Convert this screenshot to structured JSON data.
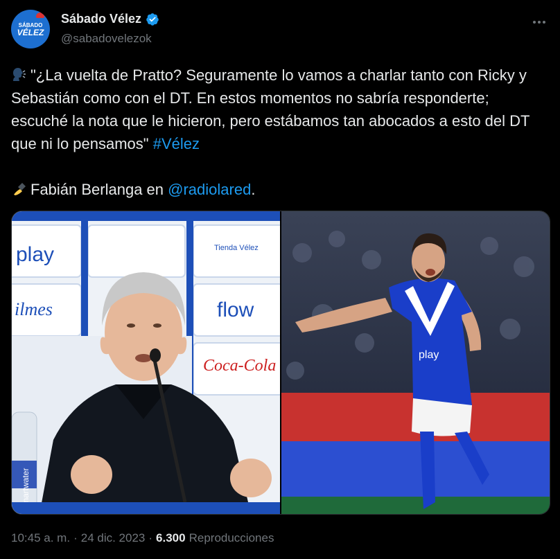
{
  "author": {
    "display_name": "Sábado Vélez",
    "handle": "@sabadovelezok",
    "avatar_text": "SÁBADO",
    "avatar_text2": "VÉLEZ",
    "avatar_icon": "avatar-logo",
    "verified_icon": "verified-badge-icon",
    "verified_color": "#1d9bf0"
  },
  "tweet": {
    "line1": "\"¿La vuelta de Pratto? Seguramente lo vamos a charlar tanto con Ricky y Sebastián como con el DT. En estos momentos no sabría responderte; escuché la nota que le hicieron, pero estábamos tan abocados a esto del DT que ni lo pensamos\"",
    "hashtag": "#Vélez",
    "credit_prefix": "Fabián Berlanga en ",
    "mention": "@radiolared",
    "credit_suffix": ".",
    "emoji1": "speaking-head-icon",
    "emoji2": "writing-hand-icon",
    "link_color": "#1d9bf0"
  },
  "media": {
    "left_logos": [
      "play",
      "Tienda Vélez",
      "ilmes",
      "flow",
      "Coca-Cola",
      "smartwater"
    ],
    "right_logos": [
      "play"
    ]
  },
  "meta": {
    "time": "10:45 a. m.",
    "sep1": "·",
    "date": "24 dic. 2023",
    "sep2": "·",
    "views": "6.300",
    "views_label": "Reproducciones"
  }
}
